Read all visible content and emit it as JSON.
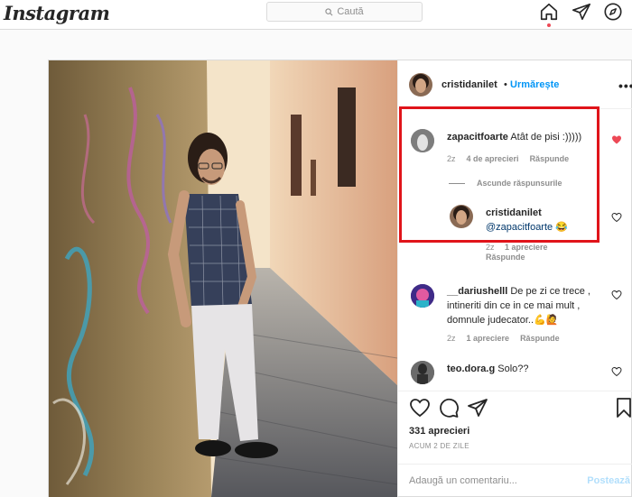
{
  "nav": {
    "logo": "Instagram",
    "search_placeholder": "Caută",
    "icons": [
      "home-icon",
      "direct-icon",
      "explore-icon"
    ]
  },
  "post": {
    "author": "cristidanilet",
    "separator": "•",
    "follow_label": "Urmărește",
    "more_label": "•••",
    "comments": [
      {
        "user": "zapacitfoarte",
        "text": "Atât de pisi :)))))",
        "time": "2z",
        "likes": "4 de aprecieri",
        "reply": "Răspunde",
        "liked": true,
        "hide_replies": "Ascunde răspunsurile",
        "replies": [
          {
            "user": "cristidanilet",
            "text": "@zapacitfoarte",
            "emoji": "😂",
            "time": "2z",
            "likes": "1 apreciere",
            "reply": "Răspunde"
          }
        ]
      },
      {
        "user": "__dariushelll",
        "text": "De pe zi ce trece , intineriti din ce in ce mai mult , domnule judecator..",
        "emoji": "💪🙋",
        "time": "2z",
        "likes": "1 apreciere",
        "reply": "Răspunde"
      },
      {
        "user": "teo.dora.g",
        "text": "Solo??"
      }
    ],
    "likes_count": "331 aprecieri",
    "date": "ACUM 2 DE ZILE",
    "add_comment_placeholder": "Adaugă un comentariu...",
    "post_button": "Postează"
  },
  "colors": {
    "accent": "#0095f6",
    "like_red": "#ed4956",
    "highlight": "#e0141a"
  }
}
